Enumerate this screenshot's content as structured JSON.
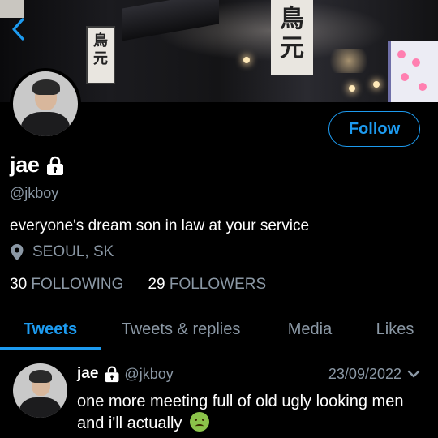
{
  "header": {
    "back_icon": "chevron-left-icon"
  },
  "profile": {
    "name": "jae",
    "lock_icon": "lock-icon",
    "handle": "@jkboy",
    "bio": "everyone's dream son in law at your service",
    "location": "SEOUL, SK",
    "location_icon": "location-pin-icon",
    "following_count": "30",
    "following_label": "FOLLOWING",
    "followers_count": "29",
    "followers_label": "FOLLOWERS",
    "follow_label": "Follow"
  },
  "tabs": [
    {
      "label": "Tweets",
      "active": true
    },
    {
      "label": "Tweets & replies",
      "active": false
    },
    {
      "label": "Media",
      "active": false
    },
    {
      "label": "Likes",
      "active": false
    }
  ],
  "tweet": {
    "name": "jae",
    "handle": "@jkboy",
    "date": "23/09/2022",
    "text": "one more meeting full of old ugly looking men and i'll actually",
    "emoji": "nauseated-face-emoji"
  },
  "colors": {
    "accent": "#1d9bf0",
    "secondary_text": "#8b98a5",
    "background": "#000000"
  }
}
